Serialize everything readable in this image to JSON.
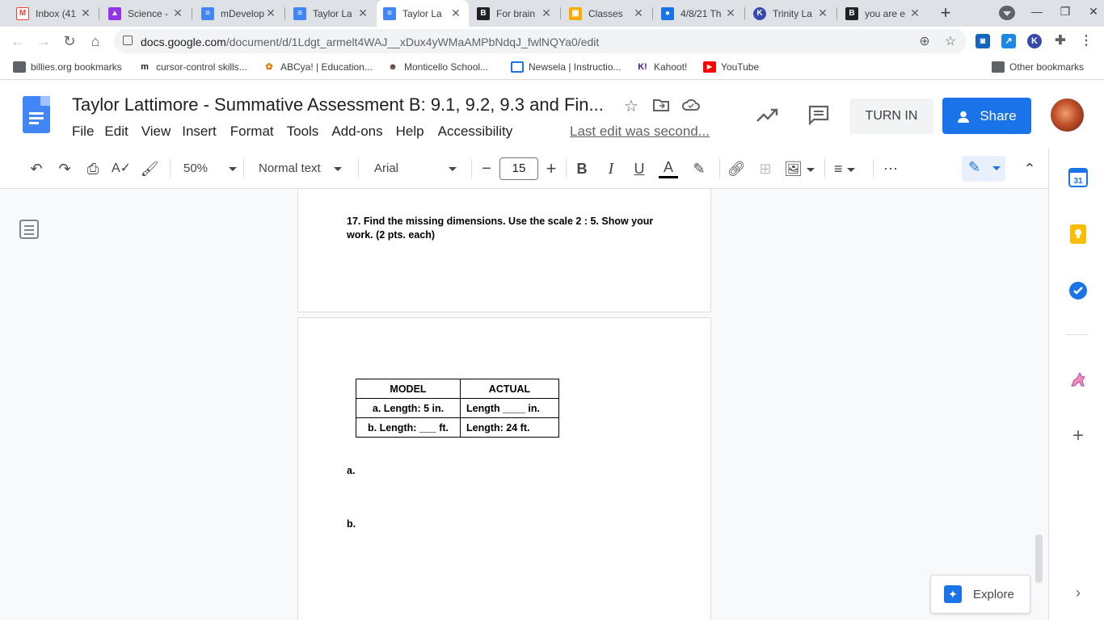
{
  "browser": {
    "tabs": [
      {
        "title": "Inbox (41",
        "icon": "gmail-icon",
        "color": "#ea4335"
      },
      {
        "title": "Science -",
        "icon": "classroom-icon",
        "color": "#9334e6"
      },
      {
        "title": "mDevelop",
        "icon": "docs-icon",
        "color": "#4285f4"
      },
      {
        "title": "Taylor La",
        "icon": "docs-icon",
        "color": "#4285f4"
      },
      {
        "title": "Taylor La",
        "icon": "docs-icon",
        "color": "#4285f4"
      },
      {
        "title": "For brain",
        "icon": "bold-b-icon",
        "color": "#202124"
      },
      {
        "title": "Classes",
        "icon": "classroom-icon",
        "color": "#f9ab00"
      },
      {
        "title": "4/8/21 Th",
        "icon": "classroom-icon",
        "color": "#1a73e8"
      },
      {
        "title": "Trinity La",
        "icon": "kami-icon",
        "color": "#3949ab"
      },
      {
        "title": "you are e",
        "icon": "bold-b-icon",
        "color": "#202124"
      }
    ],
    "url_host": "docs.google.com",
    "url_path": "/document/d/1Ldgt_armelt4WAJ__xDux4yWMaAMPbNdqJ_fwlNQYa0/edit",
    "bookmarks": [
      "billies.org bookmarks",
      "cursor-control skills...",
      "ABCya! | Education...",
      "Monticello School...",
      "Newsela | Instructio...",
      "Kahoot!",
      "YouTube"
    ],
    "other_bookmarks": "Other bookmarks"
  },
  "docs": {
    "title": "Taylor Lattimore - Summative Assessment B:  9.1, 9.2, 9.3 and Fin...",
    "menu": [
      "File",
      "Edit",
      "View",
      "Insert",
      "Format",
      "Tools",
      "Add-ons",
      "Help",
      "Accessibility"
    ],
    "last_edit": "Last edit was second...",
    "turn_in": "TURN IN",
    "share": "Share",
    "toolbar": {
      "zoom": "50%",
      "style": "Normal text",
      "font": "Arial",
      "font_size": "15"
    },
    "explore": "Explore"
  },
  "document": {
    "question": "17.  Find the missing dimensions.  Use the scale 2 : 5.  Show your work.   (2 pts. each)",
    "table": {
      "headers": [
        "MODEL",
        "ACTUAL"
      ],
      "rows": [
        [
          "a.  Length: 5 in.",
          "Length ____ in."
        ],
        [
          "b.  Length: ___ ft.",
          "Length: 24 ft."
        ]
      ]
    },
    "answer_a": "a.",
    "answer_b": "b."
  },
  "colors": {
    "accent": "#1a73e8",
    "docs_blue": "#4285f4"
  }
}
